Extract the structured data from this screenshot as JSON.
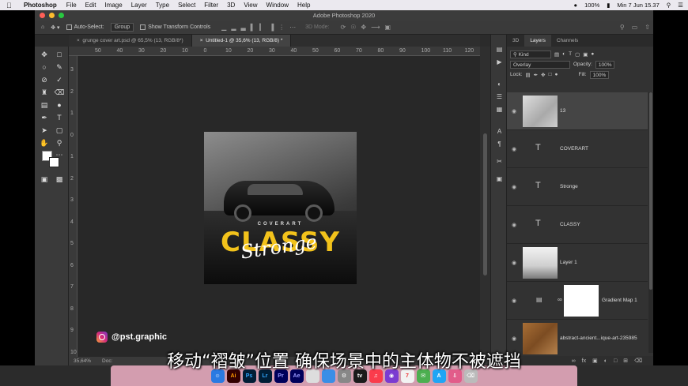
{
  "menubar": {
    "app_name": "Photoshop",
    "items": [
      "File",
      "Edit",
      "Image",
      "Layer",
      "Type",
      "Select",
      "Filter",
      "3D",
      "View",
      "Window",
      "Help"
    ],
    "battery": "100%",
    "clock": "Min 7 Jun  15.37"
  },
  "window": {
    "title": "Adobe Photoshop 2020"
  },
  "options": {
    "auto_select_label": "Auto-Select:",
    "group_value": "Group",
    "transform_label": "Show Transform Controls",
    "mode_3d": "3D Mode:"
  },
  "tabs": [
    {
      "label": "grunge cover art.psd @ 65,5% (13, RGB/8*)",
      "active": false
    },
    {
      "label": "Untitled-1 @ 35,6% (13, RGB/8) *",
      "active": true
    }
  ],
  "ruler": {
    "top": [
      "50",
      "40",
      "30",
      "20",
      "10",
      "0",
      "10",
      "20",
      "30",
      "40",
      "50",
      "60",
      "70",
      "80",
      "90",
      "100",
      "110",
      "120"
    ],
    "left": [
      "3",
      "2",
      "1",
      "0",
      "1",
      "2",
      "3",
      "4",
      "5",
      "6",
      "7",
      "8",
      "9",
      "10"
    ]
  },
  "canvas": {
    "coverart": "COVERART",
    "classy": "CLASSY",
    "stronge": "Stronge"
  },
  "status": {
    "zoom": "35,64%",
    "doc": "Doc:"
  },
  "panel": {
    "tabs": [
      {
        "label": "3D",
        "active": false
      },
      {
        "label": "Layers",
        "active": true
      },
      {
        "label": "Channels",
        "active": false
      }
    ],
    "kind": "Kind",
    "blend_mode": "Overlay",
    "opacity_label": "Opacity:",
    "opacity": "100%",
    "lock_label": "Lock:",
    "fill_label": "Fill:",
    "fill": "100%",
    "layers": [
      {
        "name": "13",
        "type": "image",
        "active": true
      },
      {
        "name": "COVERART",
        "type": "text",
        "active": false
      },
      {
        "name": "Stronge",
        "type": "text",
        "active": false
      },
      {
        "name": "CLASSY",
        "type": "text",
        "active": false
      },
      {
        "name": "Layer 1",
        "type": "gradient",
        "active": false
      },
      {
        "name": "Gradient Map 1",
        "type": "adjustment",
        "active": false
      },
      {
        "name": "abstract-ancient...ique-art-235985",
        "type": "texture",
        "active": false
      }
    ]
  },
  "overlay": {
    "instagram": "@pst.graphic",
    "subtitle": "移动“褶皱”位置 确保场景中的主体物不被遮挡"
  },
  "dock": [
    "Ai",
    "Ps",
    "Lr",
    "Pr",
    "Ae"
  ]
}
